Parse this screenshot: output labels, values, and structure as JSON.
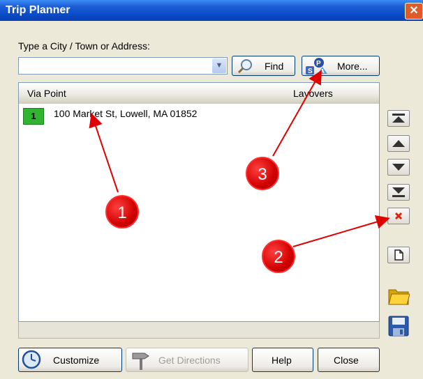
{
  "window": {
    "title": "Trip Planner",
    "close_symbol": "✕"
  },
  "search": {
    "label": "Type a City / Town or Address:",
    "value": "",
    "find_label": "Find",
    "more_label": "More..."
  },
  "list": {
    "columns": [
      "Via Point",
      "Layovers"
    ],
    "rows": [
      {
        "number": "1",
        "address": "100 Market St, Lowell, MA 01852"
      }
    ]
  },
  "side_icons": [
    "move-to-top-icon",
    "move-up-icon",
    "move-down-icon",
    "move-to-bottom-icon",
    "delete-icon",
    "new-document-icon",
    "open-folder-icon",
    "save-disk-icon"
  ],
  "footer": {
    "customize_label": "Customize",
    "directions_label": "Get Directions",
    "help_label": "Help",
    "close_label": "Close"
  },
  "annotations": {
    "badges": [
      "1",
      "2",
      "3"
    ],
    "color": "#e00000"
  },
  "colors": {
    "titlebar": "#0a4bc8",
    "row_number_bg": "#2fb52f"
  }
}
